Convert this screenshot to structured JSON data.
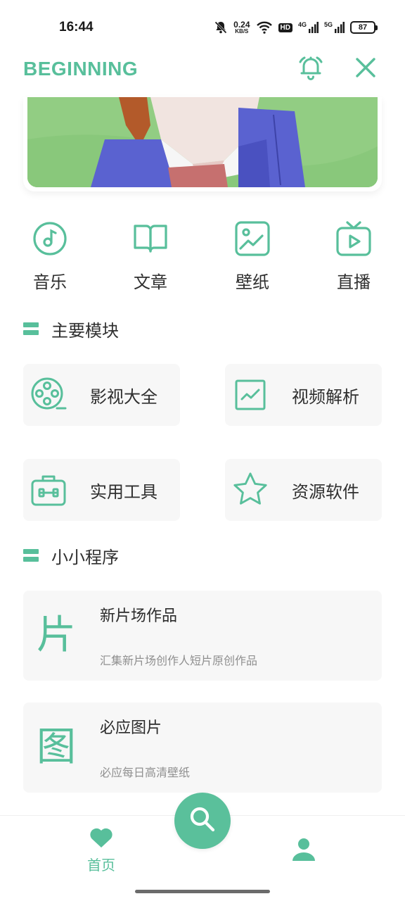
{
  "status_bar": {
    "time": "16:44",
    "net_speed_value": "0.24",
    "net_speed_unit": "KB/S",
    "hd_label": "HD",
    "sim1_label": "4G",
    "sim2_label": "5G",
    "battery_level": "87",
    "icons": [
      "mute-bell-icon",
      "wifi-icon",
      "signal-icon",
      "battery-icon"
    ]
  },
  "header": {
    "title": "BEGINNING",
    "alarm_icon": "alarm-clock-icon",
    "close_icon": "close-icon"
  },
  "quick_nav": [
    {
      "label": "音乐",
      "icon": "music-disc-icon"
    },
    {
      "label": "文章",
      "icon": "open-book-icon"
    },
    {
      "label": "壁纸",
      "icon": "image-icon"
    },
    {
      "label": "直播",
      "icon": "tv-play-icon"
    }
  ],
  "main_modules": {
    "title": "主要模块",
    "items": [
      {
        "label": "影视大全",
        "icon": "film-reel-icon"
      },
      {
        "label": "视频解析",
        "icon": "chart-frame-icon"
      },
      {
        "label": "实用工具",
        "icon": "toolbox-icon"
      },
      {
        "label": "资源软件",
        "icon": "star-icon"
      }
    ]
  },
  "mini_programs": {
    "title": "小小程序",
    "items": [
      {
        "glyph": "片",
        "title": "新片场作品",
        "desc": "汇集新片场创作人短片原创作品"
      },
      {
        "glyph": "图",
        "title": "必应图片",
        "desc": "必应每日高清壁纸"
      }
    ]
  },
  "bottom_nav": {
    "home_label": "首页",
    "home_icon": "heart-icon",
    "search_icon": "search-icon",
    "profile_icon": "user-icon"
  },
  "colors": {
    "accent": "#58bf9b",
    "card_bg": "#f7f7f7",
    "text": "#2f2f2f",
    "muted": "#8f8f8f"
  }
}
